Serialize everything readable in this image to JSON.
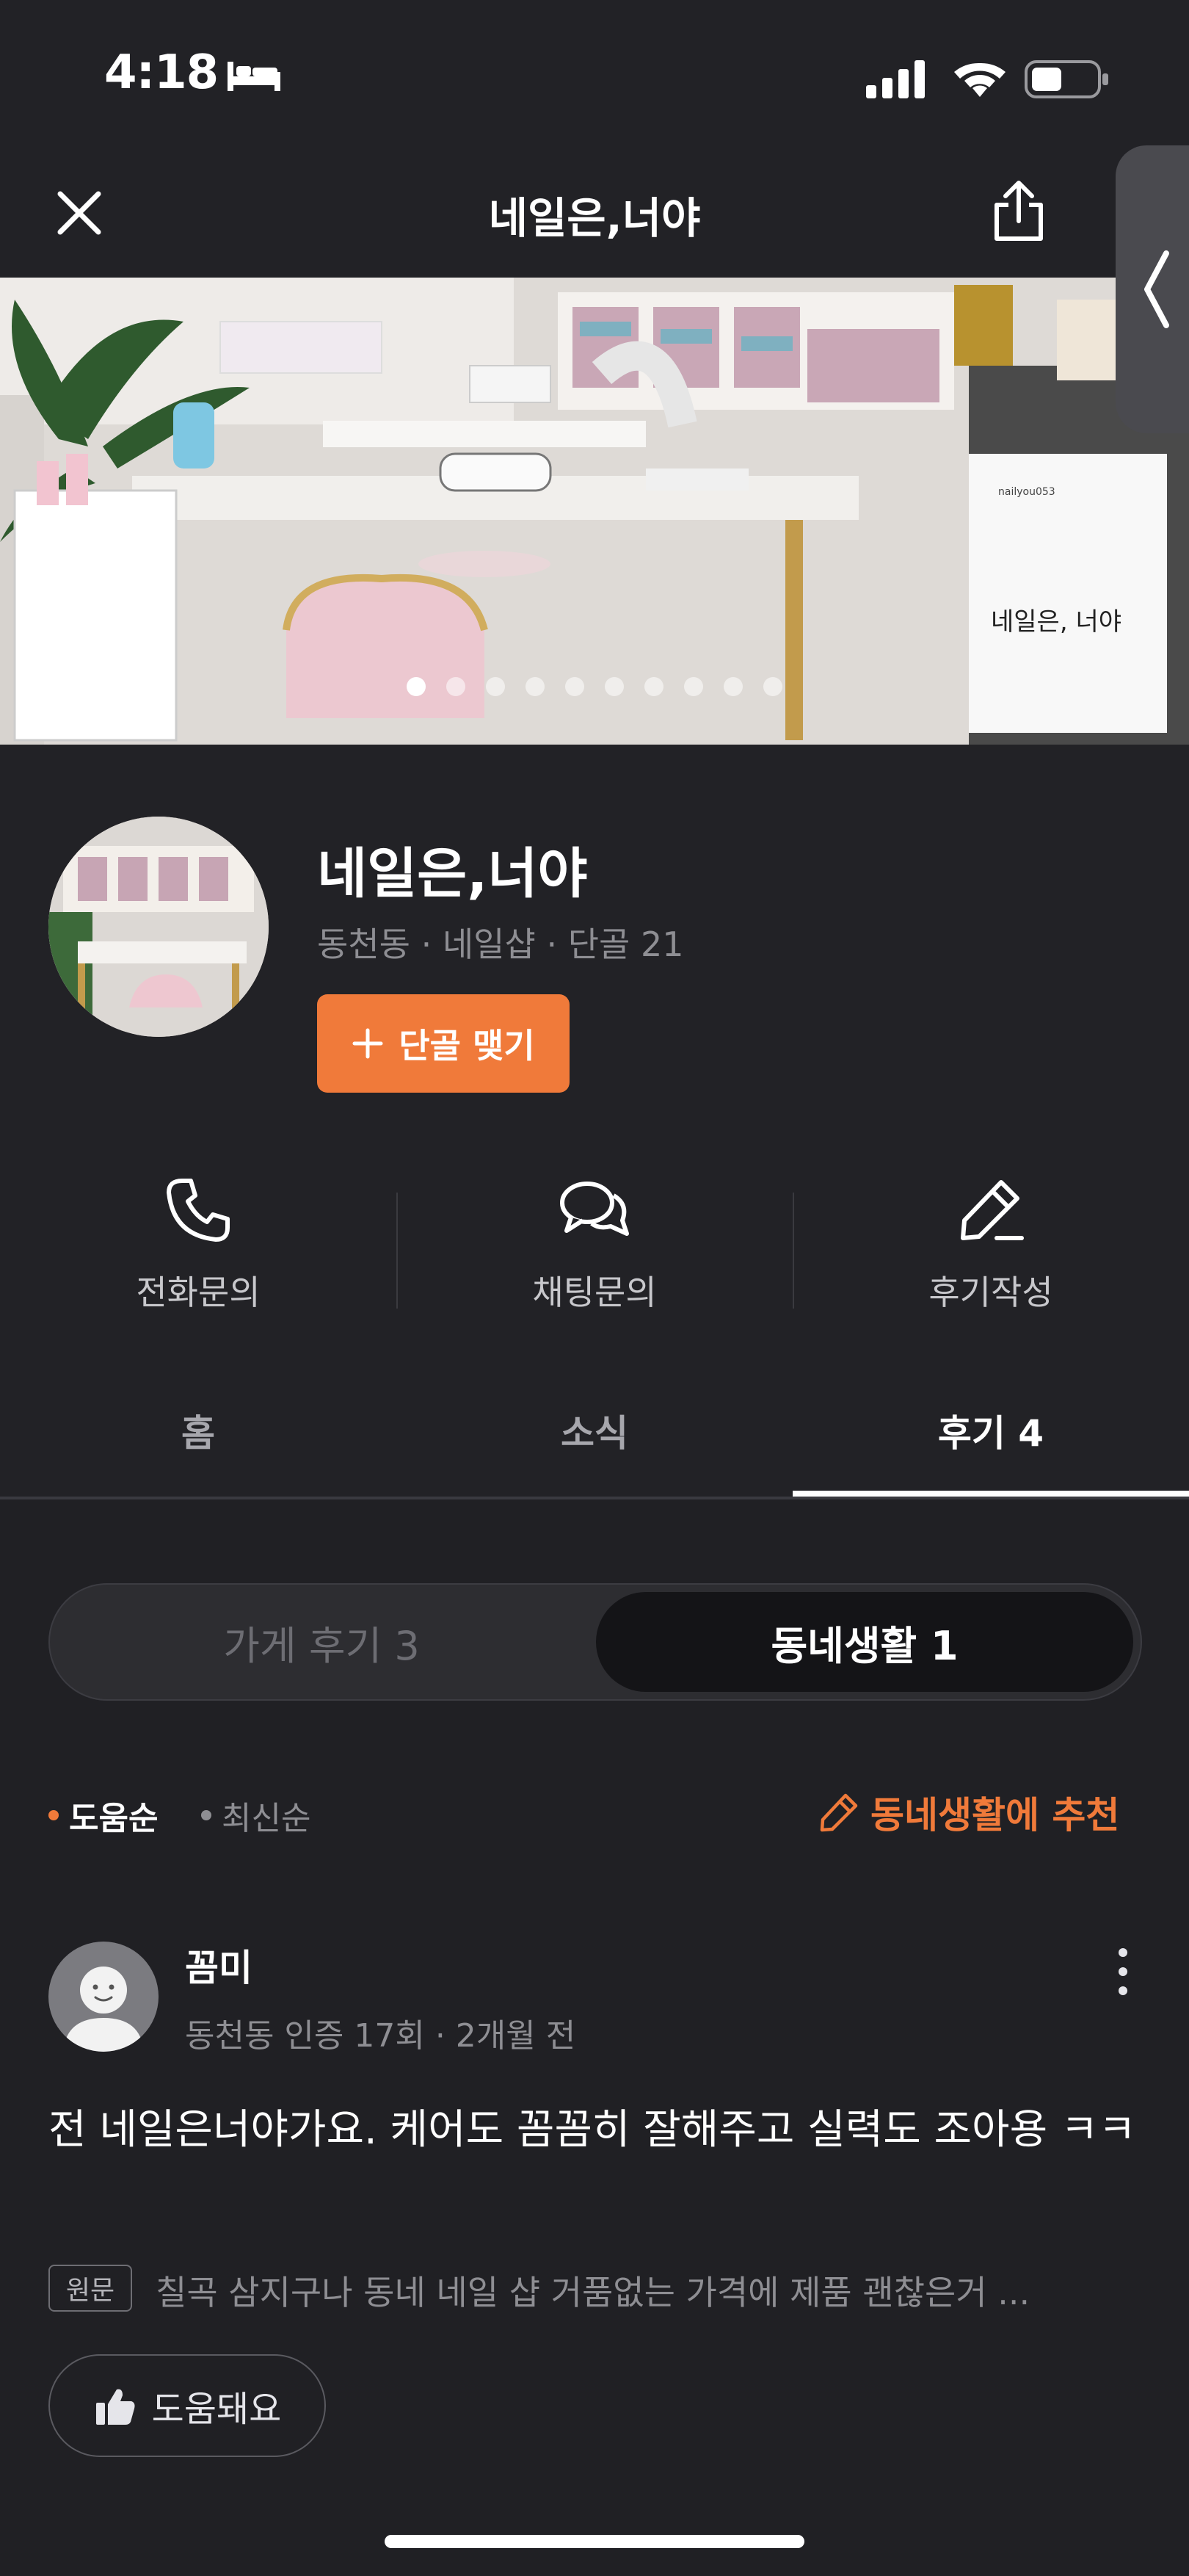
{
  "status_bar": {
    "time": "4:18"
  },
  "header": {
    "title": "네일은,너야"
  },
  "hero": {
    "image_count": 10,
    "active_index": 0,
    "sign_text": "네일은, 너야",
    "instagram": "nailyou053"
  },
  "shop": {
    "name": "네일은,너야",
    "location": "동천동",
    "category": "네일샵",
    "regulars": "단골 21",
    "regular_button": "단골 맺기"
  },
  "actions": [
    {
      "label": "전화문의",
      "icon": "phone-icon"
    },
    {
      "label": "채팅문의",
      "icon": "chat-icon"
    },
    {
      "label": "후기작성",
      "icon": "pencil-icon"
    }
  ],
  "tabs": [
    {
      "label": "홈"
    },
    {
      "label": "소식"
    },
    {
      "label": "후기 4",
      "active": true
    }
  ],
  "segmented": {
    "store_reviews": "가게 후기 3",
    "local_life": "동네생활 1",
    "selected": "local_life"
  },
  "sort": {
    "helpful": "도움순",
    "latest": "최신순",
    "recommend": "동네생활에 추천"
  },
  "review": {
    "user": "꼼미",
    "meta": "동천동 인증 17회 · 2개월 전",
    "body": "전 네일은너야가요. 케어도 꼼꼼히 잘해주고 실력도 조아용 ㅋㅋ",
    "original_badge": "원문",
    "original_text": "칠곡 삼지구나 동네 네일 샵 거품없는 가격에 제품 괜찮은거 ...",
    "helpful_button": "도움돼요"
  },
  "colors": {
    "accent": "#f07a3a",
    "background": "#222226",
    "muted_text": "#8e8e93"
  }
}
